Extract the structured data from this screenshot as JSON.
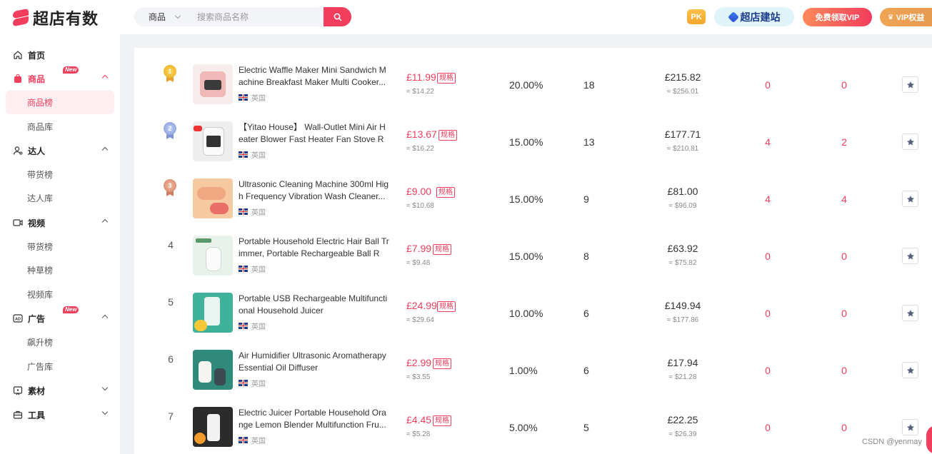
{
  "brand": {
    "name": "超店有数",
    "color": "#f23d5c"
  },
  "search": {
    "category": "商品",
    "placeholder": "搜索商品名称"
  },
  "header": {
    "pk": "PK",
    "build_site": "超店建站",
    "free_vip": "免费领取VIP",
    "vip_rights": "VIP权益"
  },
  "sidebar": {
    "home": "首页",
    "products": {
      "label": "商品",
      "badge": "New",
      "items": [
        "商品榜",
        "商品库"
      ]
    },
    "influencers": {
      "label": "达人",
      "items": [
        "带货榜",
        "达人库"
      ]
    },
    "videos": {
      "label": "视频",
      "items": [
        "带货榜",
        "种草榜",
        "视频库"
      ]
    },
    "ads": {
      "label": "广告",
      "badge": "New",
      "items": [
        "飙升榜",
        "广告库"
      ]
    },
    "materials": "素材",
    "tools": "工具"
  },
  "rows": [
    {
      "rank": "1",
      "title": "Electric Waffle Maker Mini Sandwich Machine Breakfast Maker Multi Cooker...",
      "country": "英国",
      "price": "£11.99",
      "tag": "规格",
      "price_usd": "≈ $14.22",
      "rate": "20.00%",
      "sales": "18",
      "gmv": "£215.82",
      "gmv_usd": "≈ $256.01",
      "c1": "0",
      "c2": "0"
    },
    {
      "rank": "2",
      "title": "【Yitao House】 Wall-Outlet Mini Air Heater Blower Fast Heater Fan Stove Ra...",
      "country": "英国",
      "price": "£13.67",
      "tag": "规格",
      "price_usd": "≈ $16.22",
      "rate": "15.00%",
      "sales": "13",
      "gmv": "£177.71",
      "gmv_usd": "≈ $210.81",
      "c1": "4",
      "c2": "2"
    },
    {
      "rank": "3",
      "title": "Ultrasonic Cleaning Machine 300ml High Frequency Vibration Wash Cleaner...",
      "country": "英国",
      "price": "£9.00",
      "tag": "规格",
      "price_usd": "≈ $10.68",
      "rate": "15.00%",
      "sales": "9",
      "gmv": "£81.00",
      "gmv_usd": "≈ $96.09",
      "c1": "4",
      "c2": "4"
    },
    {
      "rank": "4",
      "title": "Portable Household Electric Hair Ball Trimmer, Portable Rechargeable Ball Re...",
      "country": "英国",
      "price": "£7.99",
      "tag": "规格",
      "price_usd": "≈ $9.48",
      "rate": "15.00%",
      "sales": "8",
      "gmv": "£63.92",
      "gmv_usd": "≈ $75.82",
      "c1": "0",
      "c2": "0"
    },
    {
      "rank": "5",
      "title": "Portable USB Rechargeable Multifunctional Household Juicer",
      "country": "英国",
      "price": "£24.99",
      "tag": "规格",
      "price_usd": "≈ $29.64",
      "rate": "10.00%",
      "sales": "6",
      "gmv": "£149.94",
      "gmv_usd": "≈ $177.86",
      "c1": "0",
      "c2": "0"
    },
    {
      "rank": "6",
      "title": "Air Humidifier Ultrasonic Aromatherapy Essential Oil Diffuser",
      "country": "英国",
      "price": "£2.99",
      "tag": "规格",
      "price_usd": "≈ $3.55",
      "rate": "1.00%",
      "sales": "6",
      "gmv": "£17.94",
      "gmv_usd": "≈ $21.28",
      "c1": "0",
      "c2": "0"
    },
    {
      "rank": "7",
      "title": "Electric Juicer Portable Household Orange Lemon Blender Multifunction Fru...",
      "country": "英国",
      "price": "£4.45",
      "tag": "规格",
      "price_usd": "≈ $5.28",
      "rate": "5.00%",
      "sales": "5",
      "gmv": "£22.25",
      "gmv_usd": "≈ $26.39",
      "c1": "0",
      "c2": "0"
    }
  ],
  "watermark": "CSDN @yenmay"
}
